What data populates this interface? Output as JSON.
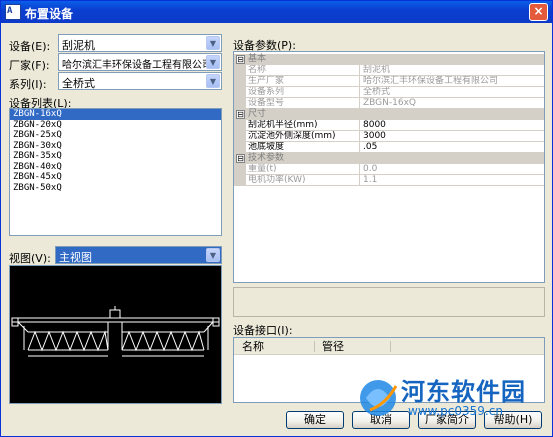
{
  "window": {
    "title": "布置设备",
    "app_icon_text": "A",
    "close_glyph": "×"
  },
  "device": {
    "label": "设备(E):",
    "value": "刮泥机"
  },
  "vendor": {
    "label": "厂家(F):",
    "value": "哈尔滨汇丰环保设备工程有限公司"
  },
  "series": {
    "label": "系列(I):",
    "value": "全桥式"
  },
  "device_list": {
    "label": "设备列表(L):",
    "items": [
      "ZBGN-16xQ",
      "ZBGN-20xQ",
      "ZBGN-25xQ",
      "ZBGN-30xQ",
      "ZBGN-35xQ",
      "ZBGN-40xQ",
      "ZBGN-45xQ",
      "ZBGN-50xQ"
    ],
    "selected_index": 0
  },
  "view": {
    "label": "视图(V):",
    "value": "主视图"
  },
  "params": {
    "label": "设备参数(P):",
    "categories": [
      {
        "name": "基本",
        "toggle": "⊟"
      },
      {
        "name": "尺寸",
        "toggle": "⊟"
      },
      {
        "name": "技术参数",
        "toggle": "⊟"
      }
    ],
    "basic": [
      {
        "name": "名称",
        "value": "刮泥机"
      },
      {
        "name": "生产厂家",
        "value": "哈尔滨汇丰环保设备工程有限公司"
      },
      {
        "name": "设备系列",
        "value": "全桥式"
      },
      {
        "name": "设备型号",
        "value": "ZBGN-16xQ"
      }
    ],
    "size": [
      {
        "name": "刮泥机半径(mm)",
        "value": "8000"
      },
      {
        "name": "沉淀池外侧深度(mm)",
        "value": "3000"
      },
      {
        "name": "池底坡度",
        "value": ".05"
      }
    ],
    "tech": [
      {
        "name": "重量(t)",
        "value": "0.0"
      },
      {
        "name": "电机功率(KW)",
        "value": "1.1"
      }
    ]
  },
  "interface": {
    "label": "设备接口(I):",
    "col_name": "名称",
    "col_pipe": "管径"
  },
  "buttons": {
    "ok": "确定",
    "cancel": "取消",
    "vendor_brief": "厂家简介",
    "help": "帮助(H)"
  },
  "watermark": {
    "text": "河东软件园",
    "url": "www.pc0359.cn"
  },
  "colors": {
    "title_bar": "#0b3fd0",
    "selection": "#316ac5",
    "dialog_bg": "#ece9d8"
  }
}
